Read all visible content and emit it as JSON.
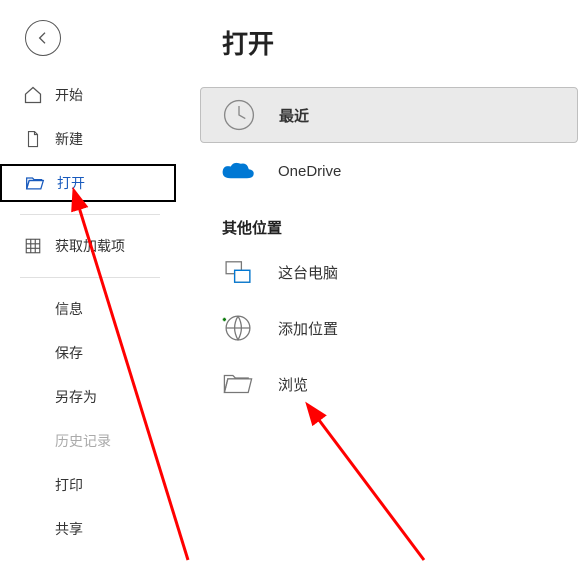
{
  "sidebar": {
    "items": [
      {
        "label": "开始"
      },
      {
        "label": "新建"
      },
      {
        "label": "打开"
      },
      {
        "label": "获取加载项"
      },
      {
        "label": "信息"
      },
      {
        "label": "保存"
      },
      {
        "label": "另存为"
      },
      {
        "label": "历史记录"
      },
      {
        "label": "打印"
      },
      {
        "label": "共享"
      }
    ]
  },
  "main": {
    "title": "打开",
    "locations": [
      {
        "label": "最近"
      },
      {
        "label": "OneDrive"
      }
    ],
    "section_header": "其他位置",
    "other_locations": [
      {
        "label": "这台电脑"
      },
      {
        "label": "添加位置"
      },
      {
        "label": "浏览"
      }
    ]
  }
}
